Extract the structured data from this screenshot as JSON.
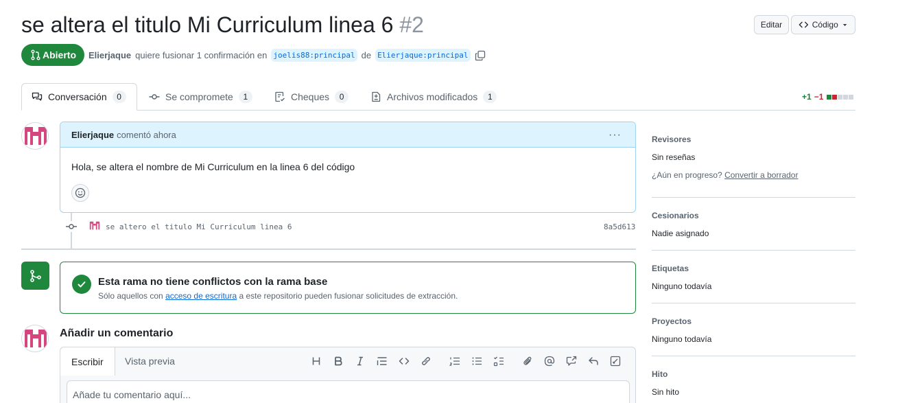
{
  "header": {
    "title": "se altera el titulo Mi Curriculum linea 6",
    "number": "#2",
    "edit_label": "Editar",
    "code_label": "Código"
  },
  "state": {
    "badge": "Abierto",
    "author": "Elierjaque",
    "text_before": "quiere fusionar 1 confirmación en",
    "base_branch": "joelis88:principal",
    "text_between": "de",
    "head_branch": "Elierjaque:principal"
  },
  "tabs": [
    {
      "label": "Conversación",
      "count": "0"
    },
    {
      "label": "Se compromete",
      "count": "1"
    },
    {
      "label": "Cheques",
      "count": "0"
    },
    {
      "label": "Archivos modificados",
      "count": "1"
    }
  ],
  "diffstat": {
    "additions": "+1",
    "deletions": "−1"
  },
  "comment": {
    "author": "Elierjaque",
    "action": "comentó ahora",
    "body": "Hola, se altera el nombre de Mi Curriculum en la linea 6 del código"
  },
  "commit": {
    "message": "se altero el titulo Mi Curriculum linea 6",
    "sha": "8a5d613"
  },
  "merge": {
    "title": "Esta rama no tiene conflictos con la rama base",
    "sub_before": "Sólo aquellos con",
    "sub_link": "acceso de escritura",
    "sub_after": "a este repositorio pueden fusionar solicitudes de extracción."
  },
  "add_comment": {
    "title": "Añadir un comentario",
    "tab_write": "Escribir",
    "tab_preview": "Vista previa",
    "placeholder": "Añade tu comentario aquí..."
  },
  "sidebar": {
    "reviewers_label": "Revisores",
    "reviewers_value": "Sin reseñas",
    "draft_question": "¿Aún en progreso?",
    "draft_link": "Convertir a borrador",
    "assignees_label": "Cesionarios",
    "assignees_value": "Nadie asignado",
    "labels_label": "Etiquetas",
    "labels_value": "Ninguno todavía",
    "projects_label": "Proyectos",
    "projects_value": "Ninguno todavía",
    "milestone_label": "Hito",
    "milestone_value": "Sin hito"
  },
  "colors": {
    "open_green": "#1f883d",
    "link_blue": "#0969da",
    "avatar_pink": "#d6467e"
  }
}
